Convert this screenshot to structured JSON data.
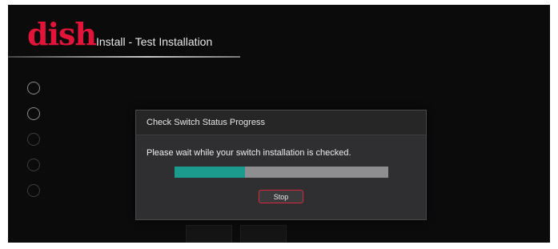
{
  "header": {
    "logo_text": "dish",
    "title": "Install - Test Installation"
  },
  "progress_dialog": {
    "title": "Check Switch Status Progress",
    "message": "Please wait while your switch installation is checked.",
    "progress": 0.33,
    "stop_label": "Stop"
  },
  "colors": {
    "brand": "#e3143a",
    "progress_fill": "#1b9a8e",
    "stop_border": "#d42a3a"
  }
}
